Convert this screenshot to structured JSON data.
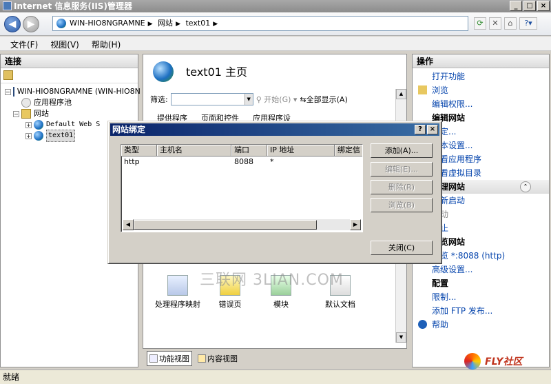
{
  "window": {
    "title": "Internet 信息服务(IIS)管理器",
    "controls": [
      "_",
      "□",
      "×"
    ]
  },
  "address": {
    "crumbs": [
      "WIN-HIO8NGRAMNE",
      "网站",
      "text01"
    ]
  },
  "menu": {
    "file": "文件(F)",
    "view": "视图(V)",
    "help": "帮助(H)"
  },
  "left": {
    "header": "连接",
    "tree": {
      "server": "WIN-HIO8NGRAMNE (WIN-HIO8N",
      "pools": "应用程序池",
      "sites": "网站",
      "default_site": "Default Web S",
      "site_text01": "text01"
    }
  },
  "center": {
    "title": "text01 主页",
    "filter_label": "筛选:",
    "start_label": "开始(G)",
    "showall_label": "全部显示(A)",
    "top_icons": [
      "提供程序",
      "页面和控件",
      "应用程序设"
    ],
    "features": [
      "处理程序映射",
      "错误页",
      "模块",
      "默认文档"
    ],
    "view_tabs": [
      "功能视图",
      "内容视图"
    ]
  },
  "right": {
    "header": "操作",
    "items": {
      "open_feature": "打开功能",
      "browse": "浏览",
      "edit_perm": "编辑权限...",
      "site_head": "编辑网站",
      "binding": "绑定...",
      "basic": "基本设置...",
      "view_apps": "查看应用程序",
      "view_vdirs": "查看虚拟目录",
      "manage_head": "管理网站",
      "restart": "重新启动",
      "start": "启动",
      "stop": "停止",
      "browse_head": "浏览网站",
      "browse_port": "浏览 *:8088 (http)",
      "advanced": "高级设置...",
      "config_head": "配置",
      "limits": "限制...",
      "ftp": "添加 FTP 发布...",
      "help": "帮助"
    }
  },
  "dialog": {
    "title": "网站绑定",
    "columns": [
      "类型",
      "主机名",
      "端口",
      "IP 地址",
      "绑定信"
    ],
    "rows": [
      {
        "type": "http",
        "host": "",
        "port": "8088",
        "ip": "*"
      }
    ],
    "buttons": {
      "add": "添加(A)...",
      "edit": "编辑(E)...",
      "remove": "删除(R)",
      "browse": "浏览(B)",
      "close": "关闭(C)"
    }
  },
  "status": {
    "text": "就绪"
  },
  "watermark": "三联网 3LIAN.COM",
  "logo_text": "FLY社区"
}
